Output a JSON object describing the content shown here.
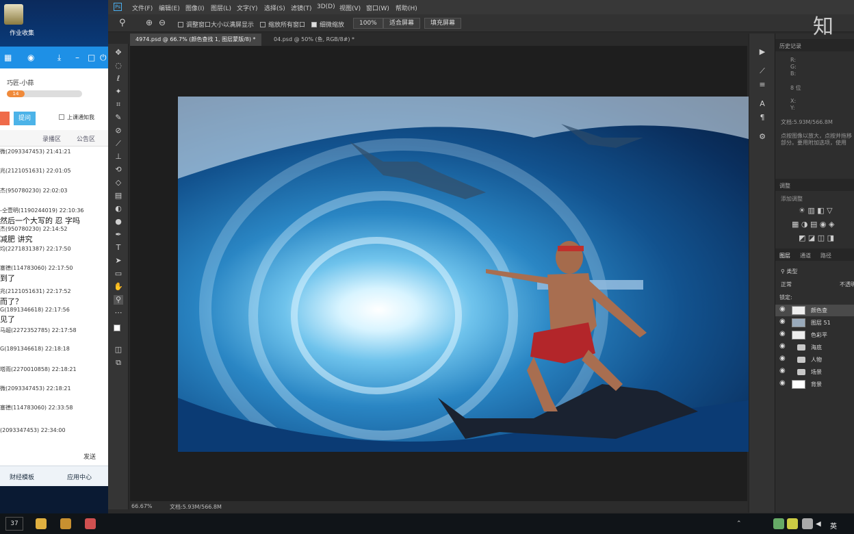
{
  "desktop": {
    "icon_label": "作业收集"
  },
  "chat": {
    "username": "巧匠-小蒜",
    "level_badge": "14",
    "btn2": "提问",
    "checkbox_label": "上课通知我",
    "tabs": [
      "",
      "录播区",
      "公告区"
    ],
    "messages": [
      {
        "header": "微(2093347453) 21:41:21",
        "body": ""
      },
      {
        "header": "兆(2121051631) 22:01:05",
        "body": ""
      },
      {
        "header": "杰(950780230) 22:02:03",
        "body": ""
      },
      {
        "header": "-仝壹明(1190244019) 22:10:36",
        "body": "然后一个大写的 忍  字吗"
      },
      {
        "header": "杰(950780230) 22:14:52",
        "body": "减肥  讲究"
      },
      {
        "header": "均(2271831387) 22:17:50",
        "body": ""
      },
      {
        "header": "塞德(114783060) 22:17:50",
        "body": "到了"
      },
      {
        "header": "兆(2121051631) 22:17:52",
        "body": "而了？"
      },
      {
        "header": "G(1891346618) 22:17:56",
        "body": "见了"
      },
      {
        "header": "马超(2272352785) 22:17:58",
        "body": ""
      },
      {
        "header": "G(1891346618) 22:18:18",
        "body": ""
      },
      {
        "header": "塔雨(2270010858) 22:18:21",
        "body": ""
      },
      {
        "header": "微(2093347453) 22:18:21",
        "body": ""
      },
      {
        "header": "塞德(114783060) 22:33:58",
        "body": ""
      },
      {
        "header": "(2093347453) 22:34:00",
        "body": ""
      }
    ],
    "send_label": "发送",
    "bottom_items": [
      "财经模板",
      "应用中心"
    ]
  },
  "photoshop": {
    "menus": [
      "文件(F)",
      "编辑(E)",
      "图像(I)",
      "图层(L)",
      "文字(Y)",
      "选择(S)",
      "滤镜(T)",
      "3D(D)",
      "视图(V)",
      "窗口(W)",
      "帮助(H)"
    ],
    "options": {
      "opt1": "调整窗口大小以满屏显示",
      "opt2": "缩放所有窗口",
      "opt3": "细微缩放",
      "zoom_value": "100%",
      "fit_screen": "适合屏幕",
      "fill_screen": "填充屏幕"
    },
    "doc_tabs": [
      "4974.psd @ 66.7% (颜色查找 1, 图层蒙版/8) *",
      "04.psd @ 50% (鱼, RGB/8#) *"
    ],
    "status": {
      "zoom": "66.67%",
      "doc": "文档:5.93M/566.8M"
    },
    "panels": {
      "history_tab": "历史记录",
      "info_rgb": [
        "R:",
        "G:",
        "B:"
      ],
      "bit_label": "8 位",
      "info_xy": [
        "X:",
        "Y:"
      ],
      "doc_info": "文档:5.93M/566.8M",
      "tip_lines": [
        "点按图像以放大，点按并拖移",
        "部分。要用附加选项，使用"
      ],
      "adjust_tab": "调整",
      "add_adjust": "添加调整",
      "layers_tabs": [
        "图层",
        "通道",
        "路径"
      ],
      "kind": "类型",
      "blend_mode": "正常",
      "opacity_label": "不透明",
      "lock_label": "锁定:",
      "layers": [
        {
          "name": "颜色查",
          "type": "adjust"
        },
        {
          "name": "图层 51",
          "type": "pixel"
        },
        {
          "name": "色彩平",
          "type": "adjust"
        },
        {
          "name": "海底",
          "type": "group"
        },
        {
          "name": "人物",
          "type": "group"
        },
        {
          "name": "场景",
          "type": "group"
        },
        {
          "name": "背景",
          "type": "pixel"
        }
      ]
    }
  },
  "watermark": "知",
  "taskbar": {
    "count": "37",
    "lang": "英"
  }
}
